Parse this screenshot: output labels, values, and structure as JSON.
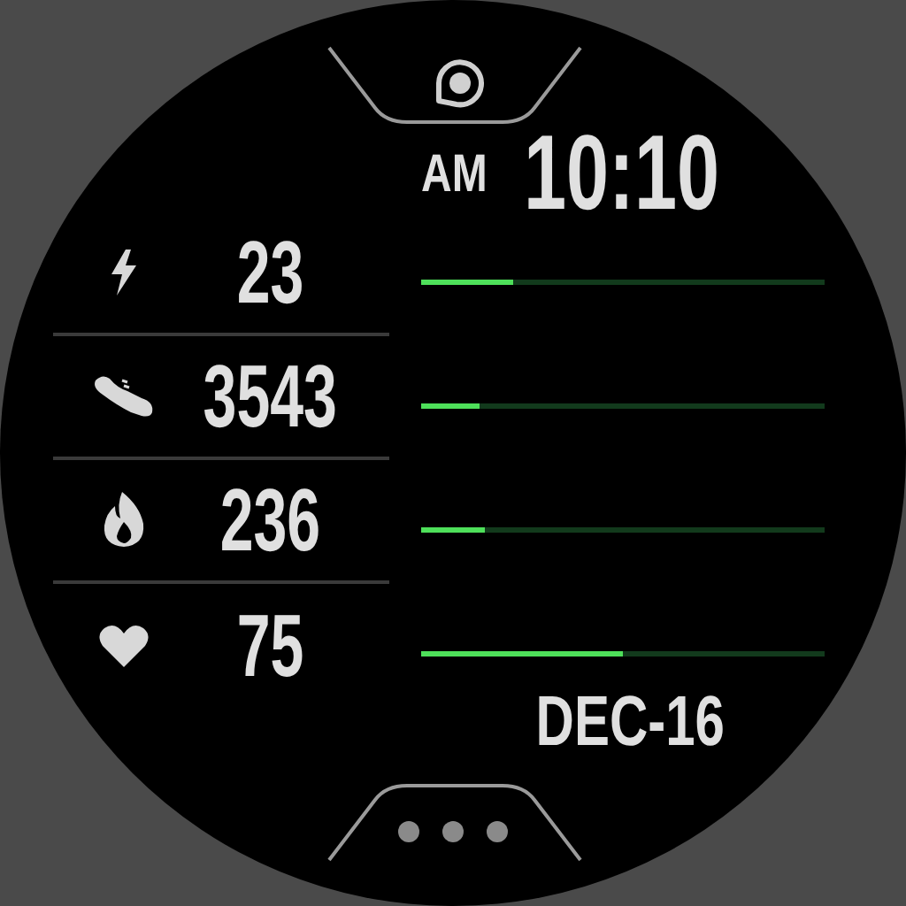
{
  "time": {
    "period": "AM",
    "clock": "10:10"
  },
  "stats": [
    {
      "kind": "energy",
      "value": "23",
      "level": 0.23
    },
    {
      "kind": "steps",
      "value": "3543",
      "level": 0.145
    },
    {
      "kind": "calories",
      "value": "236",
      "level": 0.16
    },
    {
      "kind": "heart",
      "value": "75",
      "level": 0.5
    }
  ],
  "date": "DEC-16"
}
